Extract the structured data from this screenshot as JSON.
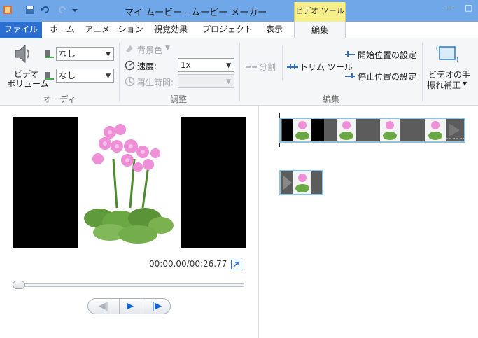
{
  "window": {
    "title": "マイ ムービー - ムービー メーカー",
    "tool_tab_header": "ビデオ ツール"
  },
  "tabs": [
    {
      "label": "ファイル"
    },
    {
      "label": "ホーム"
    },
    {
      "label": "アニメーション"
    },
    {
      "label": "視覚効果"
    },
    {
      "label": "プロジェクト"
    },
    {
      "label": "表示"
    },
    {
      "label": "編集"
    }
  ],
  "ribbon": {
    "audio": {
      "video_volume_line1": "ビデオ",
      "video_volume_line2": "ボリューム",
      "fade_in_value": "なし",
      "fade_out_value": "なし",
      "group_label": "オーディオ"
    },
    "adjust": {
      "background_color": "背景色",
      "speed_label": "速度:",
      "speed_value": "1x",
      "duration_label": "再生時間:",
      "group_label": "調整"
    },
    "edit": {
      "split": "分割",
      "trim_tool": "トリム ツール",
      "set_start": "開始位置の設定",
      "set_end": "停止位置の設定",
      "group_label": "編集"
    },
    "stabilization": {
      "line1": "ビデオの手",
      "line2": "振れ補正"
    }
  },
  "player": {
    "time": "00:00.00/00:26.77"
  },
  "colors": {
    "title_bar": "#6fa7e9",
    "file_tab": "#2b6fd0",
    "tool_tab": "#f6ef8a",
    "strip_border": "#8ec3df"
  }
}
